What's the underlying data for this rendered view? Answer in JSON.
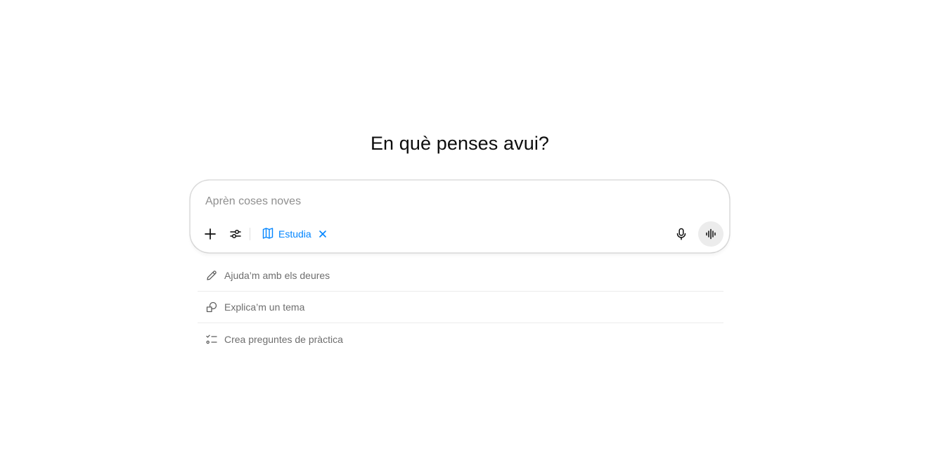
{
  "main": {
    "heading": "En què penses avui?"
  },
  "composer": {
    "placeholder": "Aprèn coses noves",
    "value": "",
    "add_icon": "plus-icon",
    "tools_icon": "sliders-icon",
    "mode_chip": {
      "label": "Estudia",
      "icon": "open-book-icon",
      "close_icon": "close-icon",
      "color": "#0285ff"
    },
    "mic_icon": "microphone-icon",
    "voice_icon": "voice-waveform-icon"
  },
  "suggestions": [
    {
      "label": "Ajuda’m amb els deures",
      "icon": "pencil-icon"
    },
    {
      "label": "Explica’m un tema",
      "icon": "shapes-icon"
    },
    {
      "label": "Crea preguntes de pràctica",
      "icon": "checklist-icon"
    }
  ]
}
